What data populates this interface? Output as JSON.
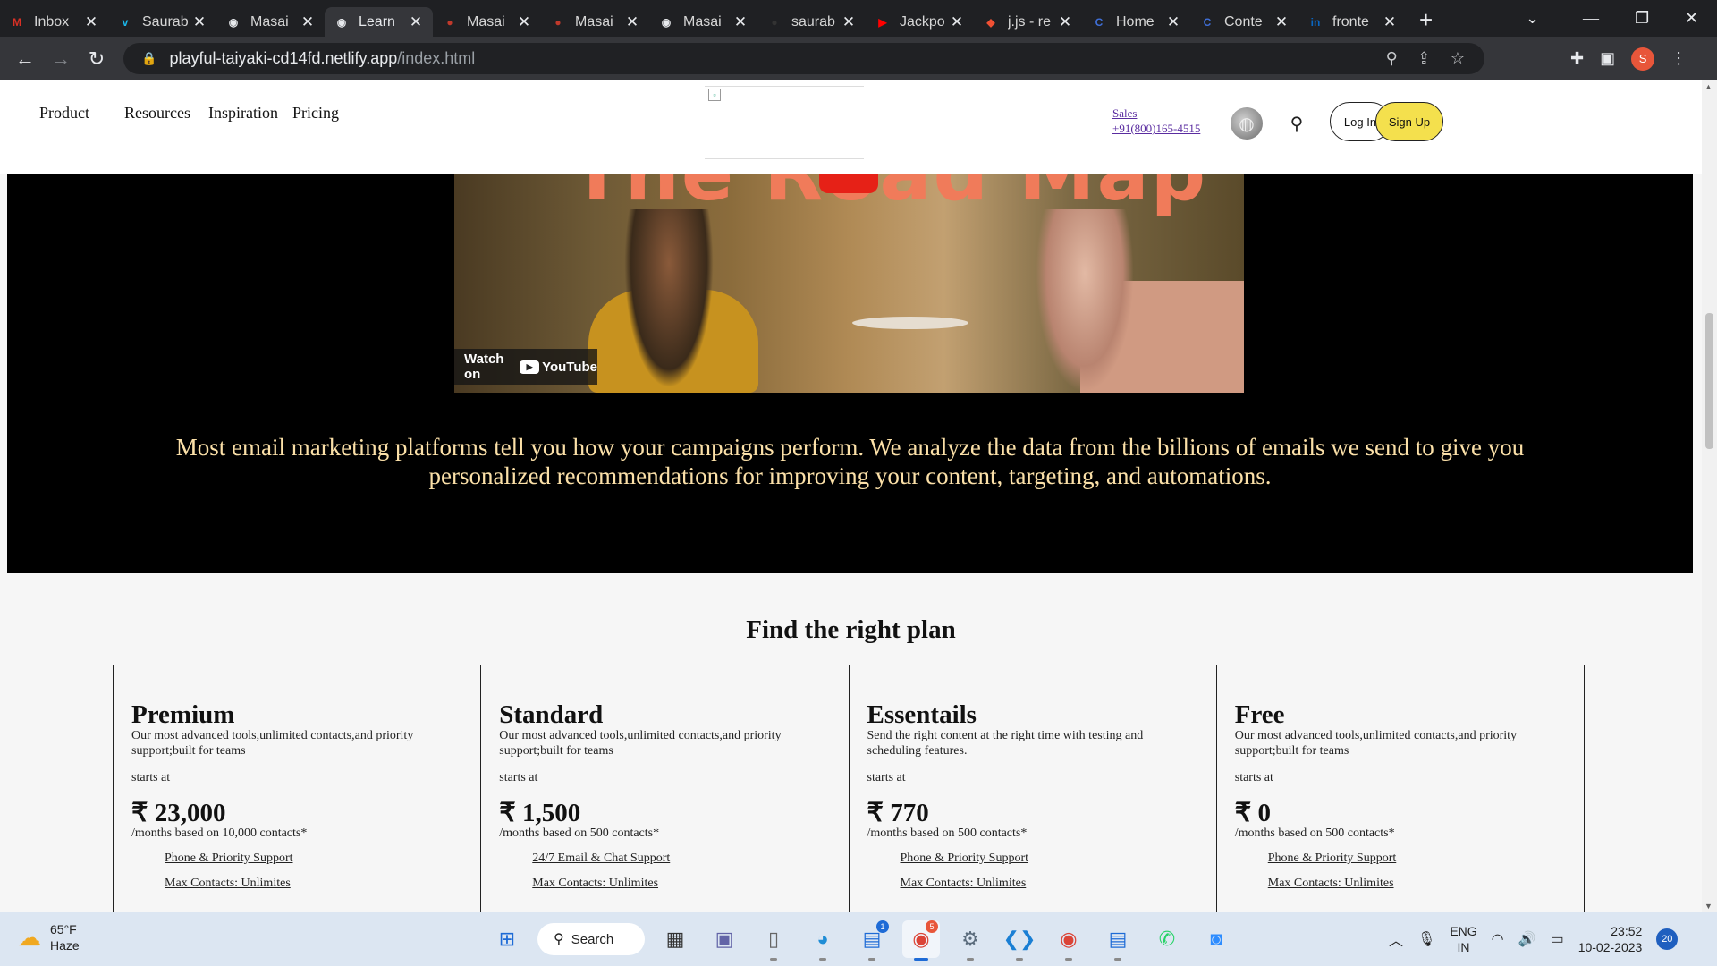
{
  "browser": {
    "tabs": [
      {
        "label": "Inbox",
        "favicon": "gmail-icon",
        "glyph": "M",
        "color": "#d93025",
        "active": false
      },
      {
        "label": "Saurab",
        "favicon": "vimeo-icon",
        "glyph": "v",
        "color": "#1ab7ea",
        "active": false
      },
      {
        "label": "Masai",
        "favicon": "globe-icon",
        "glyph": "◉",
        "color": "#e8eaed",
        "active": false
      },
      {
        "label": "Learn",
        "favicon": "globe-icon",
        "glyph": "◉",
        "color": "#e8eaed",
        "active": true
      },
      {
        "label": "Masai",
        "favicon": "masai-icon",
        "glyph": "●",
        "color": "#c0392b",
        "active": false
      },
      {
        "label": "Masai",
        "favicon": "masai-icon",
        "glyph": "●",
        "color": "#c0392b",
        "active": false
      },
      {
        "label": "Masai",
        "favicon": "globe-icon",
        "glyph": "◉",
        "color": "#e8eaed",
        "active": false
      },
      {
        "label": "saurab",
        "favicon": "github-icon",
        "glyph": "●",
        "color": "#333",
        "active": false
      },
      {
        "label": "Jackpo",
        "favicon": "youtube-icon",
        "glyph": "▶",
        "color": "#ff0000",
        "active": false
      },
      {
        "label": "j.js - re",
        "favicon": "git-icon",
        "glyph": "◆",
        "color": "#f05033",
        "active": false
      },
      {
        "label": "Home",
        "favicon": "canva-icon",
        "glyph": "C",
        "color": "#3f6fd8",
        "active": false
      },
      {
        "label": "Conte",
        "favicon": "canva-icon",
        "glyph": "C",
        "color": "#3f6fd8",
        "active": false
      },
      {
        "label": "fronte",
        "favicon": "linkedin-icon",
        "glyph": "in",
        "color": "#0a66c2",
        "active": false
      }
    ],
    "new_tab": "+",
    "url_host": "playful-taiyaki-cd14fd.netlify.app",
    "url_path": "/index.html",
    "profile_initial": "S"
  },
  "site": {
    "nav": [
      "Product",
      "Resources",
      "Inspiration",
      "Pricing"
    ],
    "sales_label": "Sales",
    "sales_phone": "+91(800)165-4515",
    "login_label": "Log In",
    "signup_label": "Sign Up",
    "video_title_text": "The Road Map",
    "watch_on": "Watch on",
    "youtube_label": "YouTube",
    "hero_text": "Most email marketing platforms tell you how your campaigns perform. We analyze the data from the billions of emails we send to give you personalized recommendations for improving your content, targeting, and automations.",
    "plans_title": "Find the right plan",
    "plans": [
      {
        "name": "Premium",
        "desc": "Our most advanced tools,unlimited contacts,and priority support;built for teams",
        "starts": "starts at",
        "price": "₹ 23,000",
        "basis": "/months based on 10,000 contacts*",
        "features": [
          "Phone & Priority Support",
          "Max Contacts: Unlimites"
        ]
      },
      {
        "name": "Standard",
        "desc": "Our most advanced tools,unlimited contacts,and priority support;built for teams",
        "starts": "starts at",
        "price": "₹ 1,500",
        "basis": "/months based on 500 contacts*",
        "features": [
          "24/7 Email & Chat Support",
          "Max Contacts: Unlimites"
        ]
      },
      {
        "name": "Essentails",
        "desc": "Send the right content at the right time with testing and scheduling features.",
        "starts": "starts at",
        "price": "₹ 770",
        "basis": "/months based on 500 contacts*",
        "features": [
          "Phone & Priority Support",
          "Max Contacts: Unlimites"
        ]
      },
      {
        "name": "Free",
        "desc": "Our most advanced tools,unlimited contacts,and priority support;built for teams",
        "starts": "starts at",
        "price": "₹ 0",
        "basis": "/months based on 500 contacts*",
        "features": [
          "Phone & Priority Support",
          "Max Contacts: Unlimites"
        ]
      }
    ]
  },
  "taskbar": {
    "temperature": "65°F",
    "weather": "Haze",
    "search_label": "Search",
    "lang_top": "ENG",
    "lang_bottom": "IN",
    "time": "23:52",
    "date": "10-02-2023",
    "notifications": "20",
    "store_badge": "1",
    "chrome_badge": "5"
  }
}
